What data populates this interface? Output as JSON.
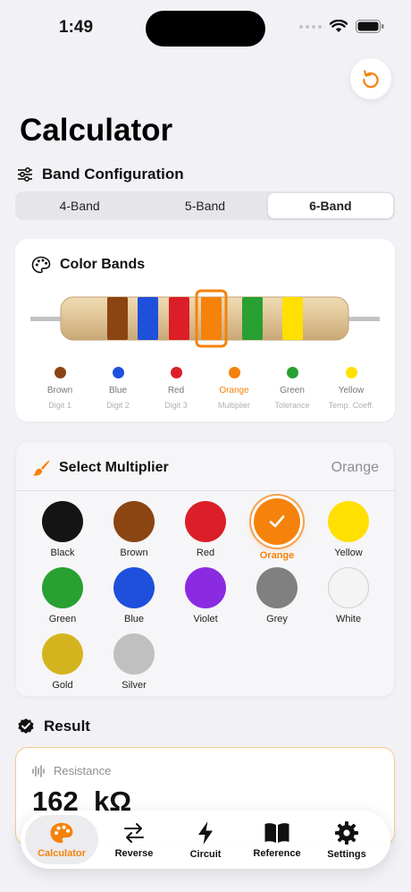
{
  "status_bar": {
    "time": "1:49"
  },
  "page": {
    "title": "Calculator"
  },
  "band_config": {
    "title": "Band Configuration",
    "options": [
      "4-Band",
      "5-Band",
      "6-Band"
    ],
    "selected": "6-Band"
  },
  "color_bands": {
    "title": "Color Bands",
    "bands": [
      {
        "color_name": "Brown",
        "role": "Digit 1",
        "hex": "#8B4513"
      },
      {
        "color_name": "Blue",
        "role": "Digit 2",
        "hex": "#1E50DC"
      },
      {
        "color_name": "Red",
        "role": "Digit 3",
        "hex": "#DC1E28"
      },
      {
        "color_name": "Orange",
        "role": "Multiplier",
        "hex": "#F5820A",
        "selected": true
      },
      {
        "color_name": "Green",
        "role": "Tolerance",
        "hex": "#28A032"
      },
      {
        "color_name": "Yellow",
        "role": "Temp. Coeff.",
        "hex": "#FFE000"
      }
    ]
  },
  "multiplier": {
    "title": "Select Multiplier",
    "selected_value": "Orange",
    "options": [
      {
        "name": "Black",
        "hex": "#141414"
      },
      {
        "name": "Brown",
        "hex": "#8B4513"
      },
      {
        "name": "Red",
        "hex": "#DC1E28"
      },
      {
        "name": "Orange",
        "hex": "#F5820A",
        "selected": true
      },
      {
        "name": "Yellow",
        "hex": "#FFE000"
      },
      {
        "name": "Green",
        "hex": "#28A032"
      },
      {
        "name": "Blue",
        "hex": "#1E50DC"
      },
      {
        "name": "Violet",
        "hex": "#8A2BE2"
      },
      {
        "name": "Grey",
        "hex": "#808080"
      },
      {
        "name": "White",
        "hex": "#F4F4F4"
      },
      {
        "name": "Gold",
        "hex": "#D4B41E"
      },
      {
        "name": "Silver",
        "hex": "#C0C0C0"
      }
    ]
  },
  "result": {
    "title": "Result",
    "label": "Resistance",
    "value": "162  kΩ"
  },
  "tabbar": {
    "items": [
      {
        "label": "Calculator",
        "icon": "palette-icon",
        "active": true
      },
      {
        "label": "Reverse",
        "icon": "arrows-swap-icon"
      },
      {
        "label": "Circuit",
        "icon": "bolt-icon"
      },
      {
        "label": "Reference",
        "icon": "book-icon"
      },
      {
        "label": "Settings",
        "icon": "gear-icon"
      }
    ]
  },
  "colors": {
    "accent": "#F5820A",
    "background": "#F2F2F6"
  }
}
